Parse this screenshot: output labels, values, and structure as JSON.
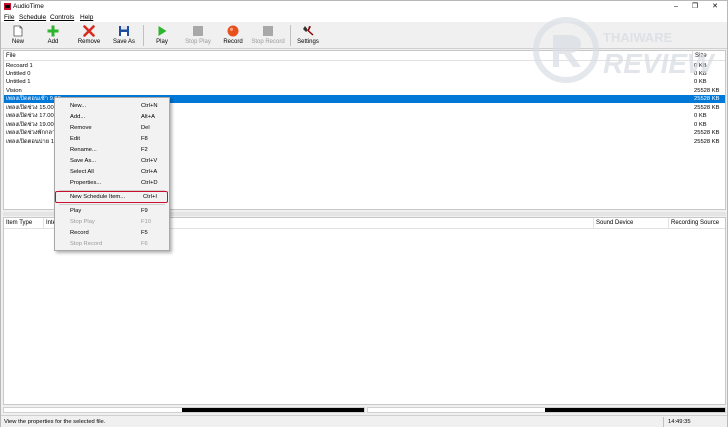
{
  "window": {
    "title": "AudioTime"
  },
  "menubar": {
    "items": [
      "File",
      "Schedule",
      "Controls",
      "Help"
    ]
  },
  "toolbar": {
    "buttons": [
      {
        "label": "New",
        "icon": "new-doc-icon",
        "enabled": true
      },
      {
        "label": "Add",
        "icon": "plus-icon",
        "enabled": true
      },
      {
        "label": "Remove",
        "icon": "x-icon",
        "enabled": true
      },
      {
        "label": "Save As",
        "icon": "floppy-icon",
        "enabled": true
      },
      {
        "label": "Play",
        "icon": "play-icon",
        "enabled": true
      },
      {
        "label": "Stop Play",
        "icon": "stop-icon",
        "enabled": false
      },
      {
        "label": "Record",
        "icon": "record-icon",
        "enabled": true
      },
      {
        "label": "Stop Record",
        "icon": "stop-icon",
        "enabled": false
      },
      {
        "label": "Settings",
        "icon": "wrench-icon",
        "enabled": true
      }
    ]
  },
  "filelist": {
    "columns": {
      "file": "File",
      "size": "Size"
    },
    "rows": [
      {
        "name": "Recoard 1",
        "size": "0 KB",
        "selected": false
      },
      {
        "name": "Untitled 0",
        "size": "0 KB",
        "selected": false
      },
      {
        "name": "Untitled 1",
        "size": "0 KB",
        "selected": false
      },
      {
        "name": "Vision",
        "size": "25528 KB",
        "selected": false
      },
      {
        "name": "เพลงเปิดตอนเช้า 9.00",
        "size": "25528 KB",
        "selected": true
      },
      {
        "name": "เพลงเปิดช่วง 15.00",
        "size": "25528 KB",
        "selected": false
      },
      {
        "name": "เพลงเปิดช่วง 17.00",
        "size": "0 KB",
        "selected": false
      },
      {
        "name": "เพลงเปิดช่วง 19.00",
        "size": "0 KB",
        "selected": false
      },
      {
        "name": "เพลงเปิดช่วงพักกลางวัน",
        "size": "25528 KB",
        "selected": false
      },
      {
        "name": "เพลงเปิดตอนบ่าย 12.00",
        "size": "25528 KB",
        "selected": false
      }
    ]
  },
  "schedule": {
    "columns": {
      "item_type": "Item Type",
      "interval": "Inte",
      "sound_device": "Sound Device",
      "recording_source": "Recording Source"
    }
  },
  "context_menu": {
    "items": [
      {
        "label": "New...",
        "shortcut": "Ctrl+N",
        "enabled": true
      },
      {
        "label": "Add...",
        "shortcut": "Alt+A",
        "enabled": true
      },
      {
        "label": "Remove",
        "shortcut": "Del",
        "enabled": true
      },
      {
        "label": "Edit",
        "shortcut": "F8",
        "enabled": true
      },
      {
        "label": "Rename...",
        "shortcut": "F2",
        "enabled": true
      },
      {
        "label": "Save As...",
        "shortcut": "Ctrl+V",
        "enabled": true
      },
      {
        "label": "Select All",
        "shortcut": "Ctrl+A",
        "enabled": true
      },
      {
        "label": "Properties...",
        "shortcut": "Ctrl+D",
        "enabled": true
      },
      {
        "label": "New Schedule Item...",
        "shortcut": "Ctrl+I",
        "enabled": true,
        "highlighted": true
      },
      {
        "label": "Play",
        "shortcut": "F9",
        "enabled": true
      },
      {
        "label": "Stop Play",
        "shortcut": "F10",
        "enabled": false
      },
      {
        "label": "Record",
        "shortcut": "F5",
        "enabled": true
      },
      {
        "label": "Stop Record",
        "shortcut": "F6",
        "enabled": false
      }
    ]
  },
  "statusbar": {
    "text": "View the properties for the selected file.",
    "time": "14:49:35"
  },
  "watermark": {
    "brand_top": "THAIWARE",
    "brand_bottom": "REVIEW"
  },
  "colors": {
    "selection": "#0078d7",
    "highlight_box": "#c8102e",
    "accent_record": "#e8501e"
  }
}
